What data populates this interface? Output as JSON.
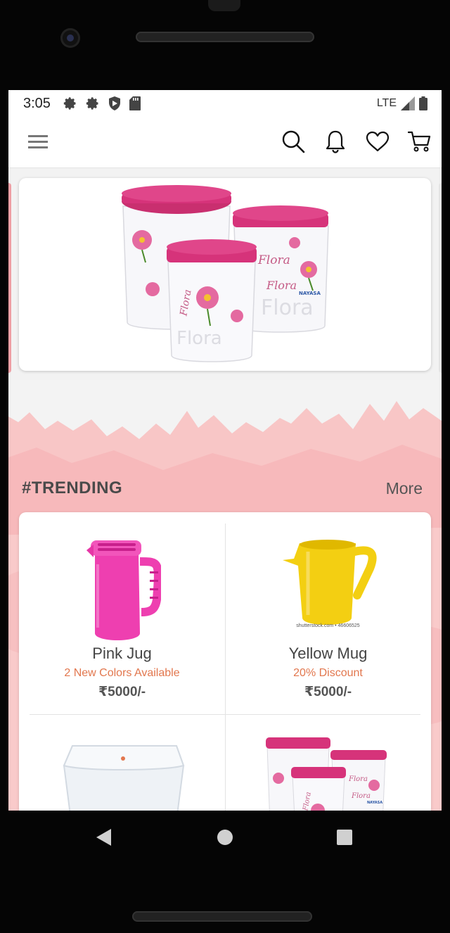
{
  "status_bar": {
    "time": "3:05",
    "network": "LTE",
    "icons": [
      "settings-icon",
      "settings-icon",
      "shield-icon",
      "sd-card-icon",
      "signal-icon",
      "battery-icon"
    ]
  },
  "app_bar": {
    "icons": [
      "menu-icon",
      "search-icon",
      "bell-icon",
      "heart-icon",
      "cart-icon"
    ]
  },
  "banner": {
    "image_text": [
      "Flora",
      "Flora",
      "Flora",
      "Flora",
      "Flora",
      "NAYASA"
    ]
  },
  "trending": {
    "title": "#TRENDING",
    "more_label": "More",
    "products": [
      {
        "name": "Pink Jug",
        "subtitle": "2 New Colors Available",
        "price": "₹5000/-",
        "image_icon": "pink-jug-image"
      },
      {
        "name": "Yellow Mug",
        "subtitle": "20% Discount",
        "price": "₹5000/-",
        "image_icon": "yellow-mug-image",
        "image_caption": "shutterstock.com • 46606525"
      },
      {
        "name": "",
        "subtitle": "",
        "price": "",
        "image_icon": "plastic-box-image"
      },
      {
        "name": "",
        "subtitle": "",
        "price": "",
        "image_icon": "flora-containers-image",
        "image_text": [
          "Flora",
          "Flora",
          "Flora",
          "NAYASA"
        ]
      }
    ]
  },
  "colors": {
    "accent_orange": "#e2774e",
    "pink_lid": "#d6337a",
    "pink_jug": "#ee3fb0",
    "yellow_mug": "#f3cf12",
    "watercolor_pink": "#f7b9bb"
  },
  "system_nav": {
    "icons": [
      "back-icon",
      "home-icon",
      "recents-icon"
    ]
  }
}
